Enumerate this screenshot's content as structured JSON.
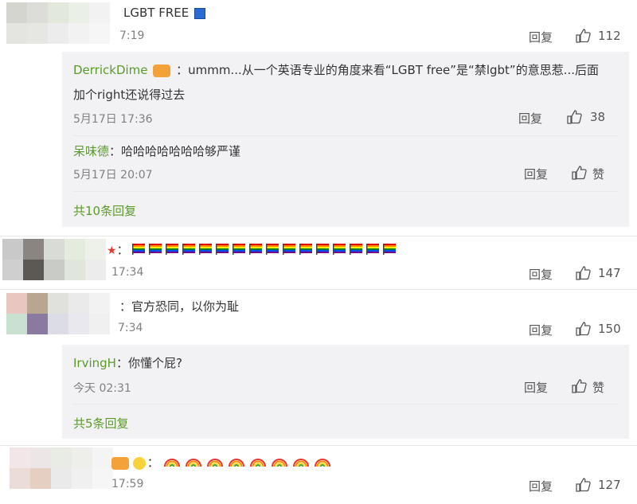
{
  "colors": {
    "username": "#5b9a28",
    "time": "#808080",
    "subbox": "#f2f2f5"
  },
  "comments": [
    {
      "text": "LGBT FREE",
      "time": "7:19",
      "reply": "回复",
      "likes": "112",
      "subreplies": [
        {
          "user": "DerrickDime",
          "colon": "：",
          "text1": "ummm...从一个英语专业的角度来看“LGBT free”是“禁lgbt”的意思惹...后面",
          "text2": "加个right还说得过去",
          "time": "5月17日 17:36",
          "reply": "回复",
          "likes": "38"
        },
        {
          "user": "呆味德",
          "colon": "：",
          "text": "哈哈哈哈哈哈哈够严谨",
          "time": "5月17日 20:07",
          "reply": "回复",
          "likes": "赞"
        }
      ],
      "more": "共10条回复"
    },
    {
      "text": "：",
      "time": "17:34",
      "reply": "回复",
      "likes": "147"
    },
    {
      "text": "：官方恐同，以你为耻",
      "time": "7:34",
      "reply": "回复",
      "likes": "150",
      "subreplies": [
        {
          "user": "IrvingH",
          "colon": "：",
          "text": "你懂个屁?",
          "time": "今天 02:31",
          "reply": "回复",
          "likes": "赞"
        }
      ],
      "more": "共5条回复"
    },
    {
      "text": "：",
      "time": "17:59",
      "reply": "回复",
      "likes": "127"
    }
  ]
}
